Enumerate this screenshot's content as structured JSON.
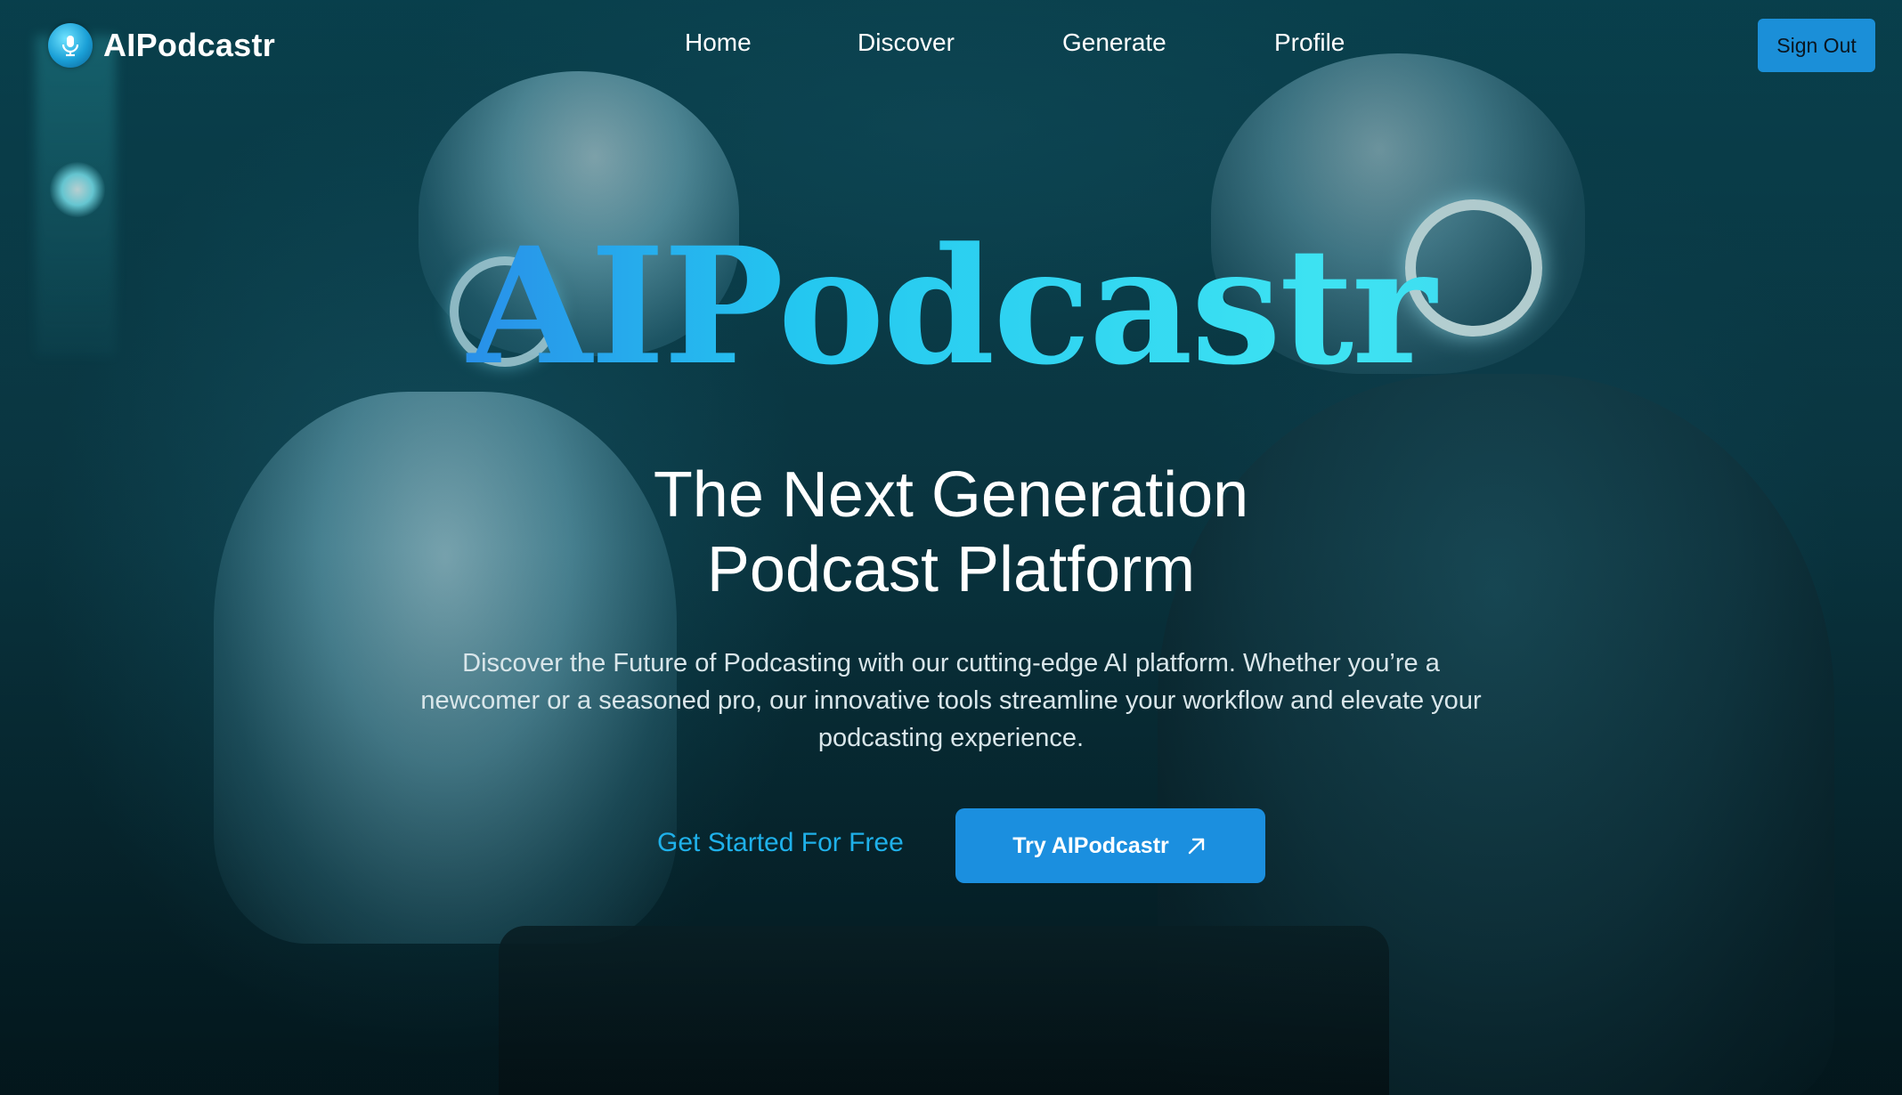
{
  "brand": {
    "name": "AIPodcastr",
    "logo_icon": "podcast-microphone-icon"
  },
  "nav": {
    "links": [
      {
        "label": "Home"
      },
      {
        "label": "Discover"
      },
      {
        "label": "Generate"
      },
      {
        "label": "Profile"
      }
    ],
    "sign_out_label": "Sign Out"
  },
  "hero": {
    "title": "AIPodcastr",
    "subtitle_line1": "The Next Generation",
    "subtitle_line2": "Podcast Platform",
    "description": "Discover the Future of Podcasting with our cutting-edge AI platform. Whether you’re a newcomer or a seasoned pro, our innovative tools streamline your workflow and elevate your podcasting experience.",
    "cta_secondary": "Get Started For Free",
    "cta_primary": "Try AIPodcastr",
    "cta_primary_icon": "arrow-up-right-icon"
  },
  "colors": {
    "accent": "#1b8fdf",
    "link": "#1fb1ea",
    "background": "#0b3b47"
  }
}
